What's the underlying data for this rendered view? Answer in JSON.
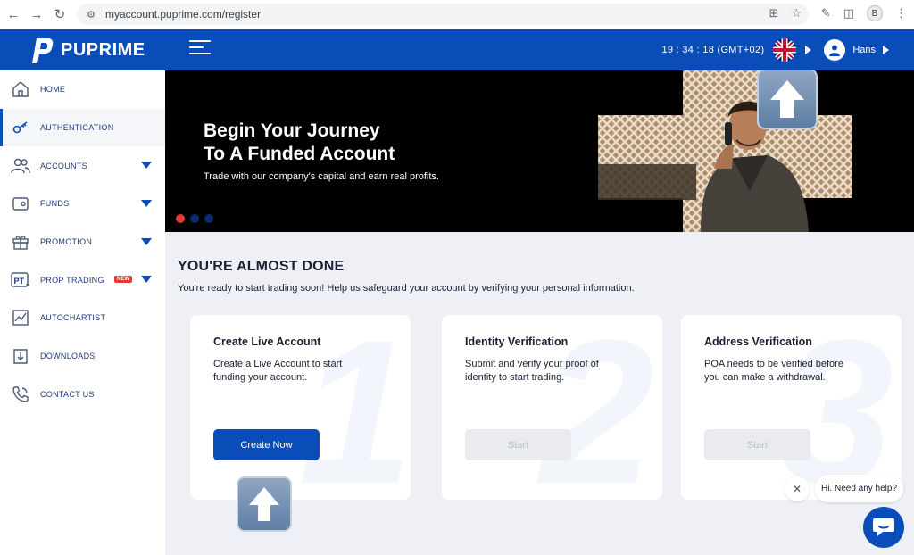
{
  "browser": {
    "url": "myaccount.puprime.com/register",
    "profile_initial": "B"
  },
  "header": {
    "brand": "PUPRIME",
    "clock": "19 : 34 : 18 (GMT+02)",
    "username": "Hans",
    "colors": {
      "brand_blue": "#0a4db8",
      "accent_red": "#e53935"
    }
  },
  "sidebar": {
    "items": [
      {
        "label": "HOME",
        "icon": "home-icon"
      },
      {
        "label": "AUTHENTICATION",
        "icon": "key-icon"
      },
      {
        "label": "ACCOUNTS",
        "icon": "users-icon"
      },
      {
        "label": "FUNDS",
        "icon": "wallet-icon"
      },
      {
        "label": "PROMOTION",
        "icon": "gift-icon"
      },
      {
        "label": "PROP TRADING",
        "icon": "pt-icon",
        "badge": "NEW"
      },
      {
        "label": "AUTOCHARTIST",
        "icon": "chart-icon"
      },
      {
        "label": "DOWNLOADS",
        "icon": "download-icon"
      },
      {
        "label": "CONTACT US",
        "icon": "phone-icon"
      }
    ]
  },
  "banner": {
    "title_line1": "Begin Your Journey",
    "title_line2": "To A Funded Account",
    "subtitle": "Trade with our company's capital and earn real profits."
  },
  "main": {
    "title": "YOU'RE ALMOST DONE",
    "subtitle": "You're ready to start trading soon! Help us safeguard your account by verifying your personal information."
  },
  "cards": [
    {
      "number": "1",
      "title": "Create Live Account",
      "desc": "Create a Live Account to start funding your account.",
      "button": "Create Now"
    },
    {
      "number": "2",
      "title": "Identity Verification",
      "desc": "Submit and verify your proof of identity to start trading.",
      "button": "Start"
    },
    {
      "number": "3",
      "title": "Address Verification",
      "desc": "POA needs to be verified before you can make a withdrawal.",
      "button": "Start"
    }
  ],
  "chat": {
    "greeting": "Hi. Need any help?"
  }
}
